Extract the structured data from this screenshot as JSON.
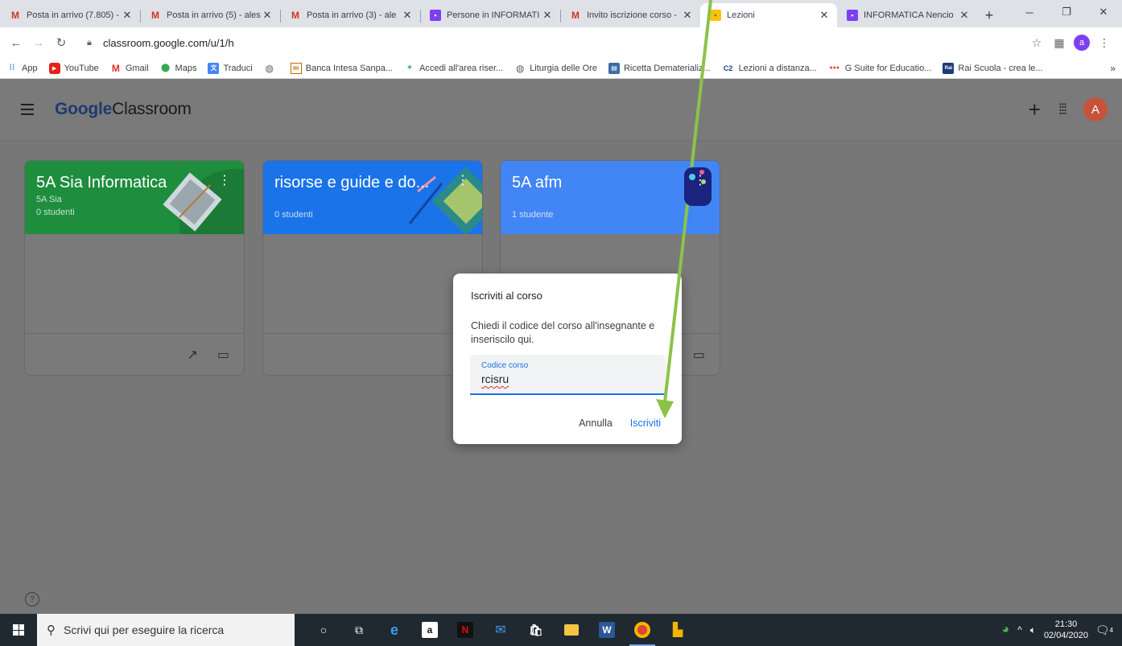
{
  "browser": {
    "tabs": [
      {
        "title": "Posta in arrivo (7.805) -",
        "icon": "gmail-icon"
      },
      {
        "title": "Posta in arrivo (5) - ales",
        "icon": "gmail-icon"
      },
      {
        "title": "Posta in arrivo (3) - ale",
        "icon": "gmail-icon"
      },
      {
        "title": "Persone in INFORMATI",
        "icon": "people-icon"
      },
      {
        "title": "Invito iscrizione corso -",
        "icon": "gmail-icon"
      },
      {
        "title": "Lezioni",
        "icon": "classroom-icon"
      },
      {
        "title": "INFORMATICA Nencio",
        "icon": "people-icon"
      }
    ],
    "url": "classroom.google.com/u/1/h",
    "profile_initial": "a",
    "bookmarks": [
      {
        "label": "App",
        "icon": "apps-grid-icon"
      },
      {
        "label": "YouTube",
        "icon": "youtube-icon"
      },
      {
        "label": "Gmail",
        "icon": "gmail-icon"
      },
      {
        "label": "Maps",
        "icon": "maps-icon"
      },
      {
        "label": "Traduci",
        "icon": "translate-icon"
      },
      {
        "label": "",
        "icon": "globe-icon"
      },
      {
        "label": "Banca Intesa Sanpa...",
        "icon": "bank-icon"
      },
      {
        "label": "Accedi all'area riser...",
        "icon": "star-icon"
      },
      {
        "label": "Liturgia delle Ore",
        "icon": "globe-icon"
      },
      {
        "label": "Ricetta Dematerializ...",
        "icon": "document-icon"
      },
      {
        "label": "Lezioni a distanza...",
        "icon": "c2-icon"
      },
      {
        "label": "G Suite for Educatio...",
        "icon": "gsuite-icon"
      },
      {
        "label": "Rai Scuola - crea le...",
        "icon": "rai-icon"
      }
    ]
  },
  "app": {
    "brand_google": "Google",
    "brand_product": "Classroom",
    "avatar_initial": "A"
  },
  "cards": [
    {
      "title": "5A Sia Informatica",
      "section": "5A Sia",
      "count": "0 studenti",
      "color": "#1e8e3e"
    },
    {
      "title": "risorse e guide e do...",
      "section": "",
      "count": "0 studenti",
      "color": "#1a73e8"
    },
    {
      "title": "5A afm",
      "section": "",
      "count": "1 studente",
      "color": "#4285f4"
    }
  ],
  "dialog": {
    "title": "Iscriviti al corso",
    "body": "Chiedi il codice del corso all'insegnante e inseriscilo qui.",
    "field_label": "Codice corso",
    "field_value": "rcisru",
    "cancel_label": "Annulla",
    "join_label": "Iscriviti"
  },
  "taskbar": {
    "search_placeholder": "Scrivi qui per eseguire la ricerca",
    "time": "21:30",
    "date": "02/04/2020",
    "notifications": "4"
  },
  "colors": {
    "accent": "#1a73e8",
    "arrow": "#8bc34a"
  }
}
